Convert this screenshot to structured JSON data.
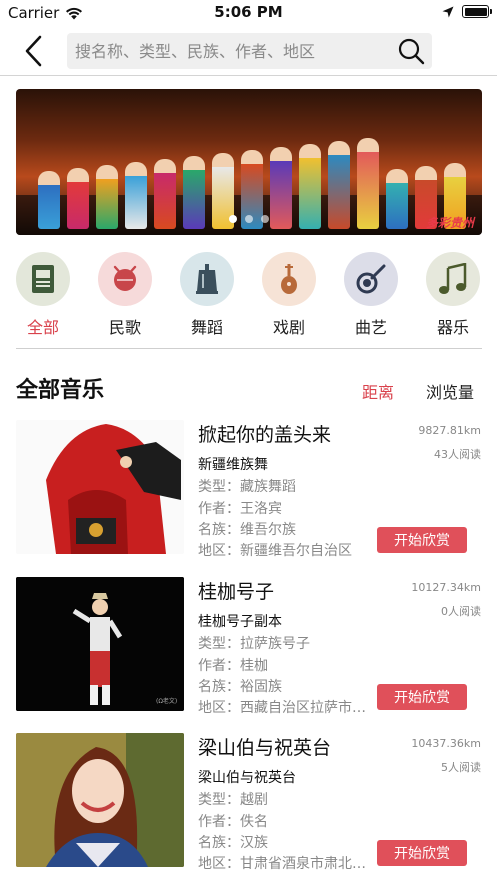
{
  "status": {
    "carrier": "Carrier",
    "time": "5:06 PM"
  },
  "search": {
    "placeholder": "搜名称、类型、民族、作者、地区"
  },
  "banner": {
    "watermark": "多彩贵州"
  },
  "categories": [
    {
      "label": "全部",
      "icon": "sheet-music-icon",
      "bg": "#e3e7da",
      "color": "#3f5a3a",
      "active": true
    },
    {
      "label": "民歌",
      "icon": "drum-icon",
      "bg": "#f6dada",
      "color": "#c8464a",
      "active": false
    },
    {
      "label": "舞蹈",
      "icon": "bell-icon",
      "bg": "#d8e6ea",
      "color": "#3a4f5c",
      "active": false
    },
    {
      "label": "戏剧",
      "icon": "pipa-icon",
      "bg": "#f6e3d6",
      "color": "#b86a3a",
      "active": false
    },
    {
      "label": "曲艺",
      "icon": "banjo-icon",
      "bg": "#dcdde8",
      "color": "#2f3a52",
      "active": false
    },
    {
      "label": "器乐",
      "icon": "music-note-icon",
      "bg": "#e6e8dc",
      "color": "#4b5a2c",
      "active": false
    }
  ],
  "section": {
    "title": "全部音乐",
    "sort_distance": "距离",
    "sort_views": "浏览量"
  },
  "labels": {
    "type": "类型：",
    "author": "作者：",
    "ethnicity": "名族：",
    "region": "地区："
  },
  "play_label": "开始欣赏",
  "items": [
    {
      "title": "掀起你的盖头来",
      "subtitle": "新疆维族舞",
      "type": "藏族舞蹈",
      "author": "王洛宾",
      "ethnicity": "维吾尔族",
      "region": "新疆维吾尔自治区",
      "distance": "9827.81km",
      "reads": "43人阅读"
    },
    {
      "title": "桂枷号子",
      "subtitle": "桂枷号子副本",
      "type": "拉萨族号子",
      "author": "桂枷",
      "ethnicity": "裕固族",
      "region": "西藏自治区拉萨市…",
      "distance": "10127.34km",
      "reads": "0人阅读"
    },
    {
      "title": "梁山伯与祝英台",
      "subtitle": "梁山伯与祝英台",
      "type": "越剧",
      "author": "佚名",
      "ethnicity": "汉族",
      "region": "甘肃省酒泉市肃北…",
      "distance": "10437.36km",
      "reads": "5人阅读"
    }
  ]
}
